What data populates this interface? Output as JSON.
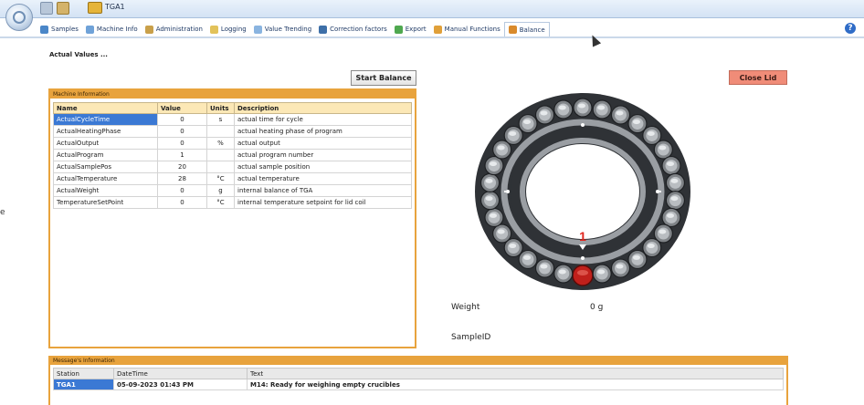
{
  "app": {
    "tga_label": "TGA1"
  },
  "tabs": [
    {
      "label": "Samples",
      "color": "#4a86c8"
    },
    {
      "label": "Machine Info",
      "color": "#6fa2d8"
    },
    {
      "label": "Administration",
      "color": "#c9a04a"
    },
    {
      "label": "Logging",
      "color": "#e2c25a"
    },
    {
      "label": "Value Trending",
      "color": "#8ab4e0"
    },
    {
      "label": "Correction factors",
      "color": "#3d6fa8"
    },
    {
      "label": "Export",
      "color": "#4fa84f"
    },
    {
      "label": "Manual Functions",
      "color": "#e0a03a"
    },
    {
      "label": "Balance",
      "color": "#d98a2b"
    }
  ],
  "active_tab": "Balance",
  "content": {
    "actual_values_label": "Actual Values ...",
    "start_button": "Start Balance",
    "close_button": "Close Lid"
  },
  "machine_info": {
    "title": "Machine Information",
    "columns": [
      "Name",
      "Value",
      "Units",
      "Description"
    ],
    "rows": [
      {
        "name": "ActualCycleTime",
        "value": "0",
        "units": "s",
        "description": "actual time for cycle"
      },
      {
        "name": "ActualHeatingPhase",
        "value": "0",
        "units": "",
        "description": "actual heating phase of program"
      },
      {
        "name": "ActualOutput",
        "value": "0",
        "units": "%",
        "description": "actual output"
      },
      {
        "name": "ActualProgram",
        "value": "1",
        "units": "",
        "description": "actual program number"
      },
      {
        "name": "ActualSamplePos",
        "value": "20",
        "units": "",
        "description": "actual sample position"
      },
      {
        "name": "ActualTemperature",
        "value": "28",
        "units": "°C",
        "description": "actual temperature"
      },
      {
        "name": "ActualWeight",
        "value": "0",
        "units": "g",
        "description": "internal balance of TGA"
      },
      {
        "name": "TemperatureSetPoint",
        "value": "0",
        "units": "°C",
        "description": "internal temperature setpoint for lid coil"
      }
    ]
  },
  "carousel": {
    "position_marker": "1",
    "positions": 30,
    "active_crucible_color": "#c0201b"
  },
  "balance": {
    "weight_label": "Weight",
    "weight_value": "0 g",
    "sample_id_label": "SampleID"
  },
  "messages": {
    "title": "Message's Information",
    "columns": [
      "Station",
      "DateTime",
      "Text"
    ],
    "rows": [
      {
        "station": "TGA1",
        "datetime": "05-09-2023 01:43 PM",
        "text": "M14: Ready for weighing empty crucibles"
      }
    ]
  },
  "left_fragment": "e",
  "colors": {
    "accent_orange": "#e8a33d",
    "selection_blue": "#3b79d4",
    "close_button": "#f08c78"
  }
}
